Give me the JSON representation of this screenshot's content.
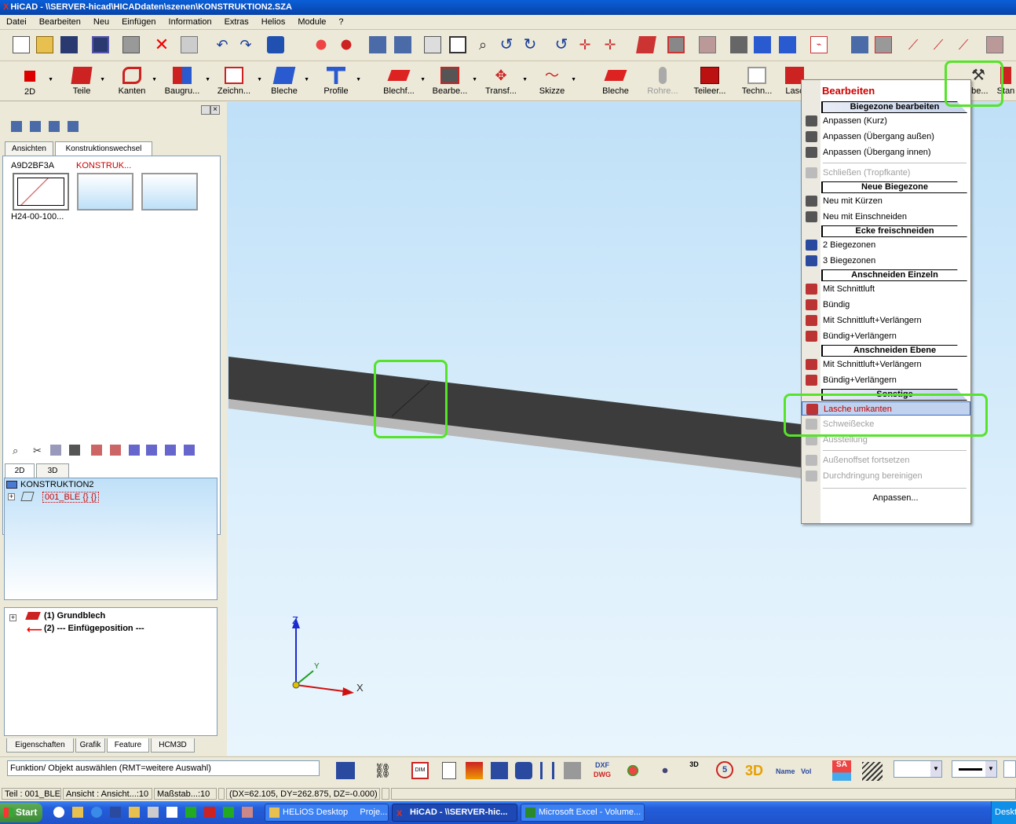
{
  "window": {
    "title": "HiCAD - \\\\SERVER-hicad\\HICADdaten\\szenen\\KONSTRUKTION2.SZA",
    "logo": "X"
  },
  "menu": [
    "Datei",
    "Bearbeiten",
    "Neu",
    "Einfügen",
    "Information",
    "Extras",
    "Helios",
    "Module",
    "?"
  ],
  "toolbar2": [
    {
      "label": "2D",
      "icon": "red-square"
    },
    {
      "label": "Teile",
      "icon": "red-cube"
    },
    {
      "label": "Kanten",
      "icon": "red-edge"
    },
    {
      "label": "Baugru...",
      "icon": "assembly"
    },
    {
      "label": "Zeichn...",
      "icon": "drawing"
    },
    {
      "label": "Bleche",
      "icon": "sheet"
    },
    {
      "label": "Profile",
      "icon": "profile"
    },
    {
      "label": "Blechf...",
      "icon": "sheet-feature"
    },
    {
      "label": "Bearbe...",
      "icon": "edit-solid"
    },
    {
      "label": "Transf...",
      "icon": "transform"
    },
    {
      "label": "Skizze",
      "icon": "sketch"
    },
    {
      "label": "Bleche",
      "icon": "sheet-red"
    },
    {
      "label": "Rohre...",
      "icon": "pipe"
    },
    {
      "label": "Teileer...",
      "icon": "part-create"
    },
    {
      "label": "Techn...",
      "icon": "tech"
    },
    {
      "label": "Lasc",
      "icon": "tab"
    },
    {
      "label": "rbe...",
      "icon": "hammer-icon"
    },
    {
      "label": "Stan",
      "icon": "standard"
    }
  ],
  "left": {
    "tabs_top": [
      "Ansichten",
      "Konstruktionswechsel"
    ],
    "thumbs": [
      {
        "label": "A9D2BF3A",
        "caption": "H24-00-100..."
      },
      {
        "label": "KONSTRUK..."
      },
      {
        "label": ""
      }
    ],
    "tabs_mid": [
      "2D",
      "3D"
    ],
    "tree_root": "KONSTRUKTION2",
    "tree_child": "001_BLE {} {}",
    "feature_items": [
      "(1) Grundblech",
      "(2) --- Einfügeposition ---"
    ],
    "tabs_bottom": [
      "Eigenschaften",
      "Grafik",
      "Feature",
      "HCM3D"
    ]
  },
  "axes": {
    "z": "Z",
    "y": "Y",
    "x": "X"
  },
  "context_menu": {
    "title": "Bearbeiten",
    "sections": [
      {
        "header": "Biegezone bearbeiten",
        "items": [
          {
            "t": "Anpassen (Kurz)"
          },
          {
            "t": "Anpassen (Übergang außen)"
          },
          {
            "t": "Anpassen (Übergang innen)"
          },
          {
            "t": "Schließen (Tropfkante)",
            "dis": true
          }
        ]
      },
      {
        "header": "Neue Biegezone",
        "items": [
          {
            "t": "Neu mit Kürzen"
          },
          {
            "t": "Neu mit Einschneiden"
          }
        ]
      },
      {
        "header": "Ecke freischneiden",
        "items": [
          {
            "t": "2 Biegezonen"
          },
          {
            "t": "3 Biegezonen"
          }
        ]
      },
      {
        "header": "Anschneiden Einzeln",
        "items": [
          {
            "t": "Mit Schnittluft"
          },
          {
            "t": "Bündig"
          },
          {
            "t": "Mit Schnittluft+Verlängern"
          },
          {
            "t": "Bündig+Verlängern"
          }
        ]
      },
      {
        "header": "Anschneiden Ebene",
        "items": [
          {
            "t": "Mit Schnittluft+Verlängern"
          },
          {
            "t": "Bündig+Verlängern"
          }
        ]
      },
      {
        "header": "Sonstige",
        "items": [
          {
            "t": "Lasche umkanten",
            "hi": true
          },
          {
            "t": "Schweißecke",
            "dis": true
          },
          {
            "t": "Ausstellung",
            "dis": true
          },
          {
            "t": "Außenoffset fortsetzen",
            "dis": true
          },
          {
            "t": "Durchdringung bereinigen",
            "dis": true
          }
        ]
      }
    ],
    "footer": "Anpassen..."
  },
  "command": {
    "prompt": "Funktion/ Objekt auswählen (RMT=weitere Auswahl)"
  },
  "status": {
    "part": "Teil : 001_BLE",
    "view": "Ansicht : Ansicht...:10",
    "scale": "Maßstab...:10",
    "coords": "(DX=62.105, DY=262.875, DZ=-0.000)"
  },
  "taskbar": {
    "start": "Start",
    "tasks": [
      "HELiOS Desktop     Proje...",
      "HiCAD - \\\\SERVER-hic...",
      "Microsoft Excel - Volume..."
    ],
    "tray": "Deskt"
  },
  "colors": {
    "title": "#0842a8",
    "highlight": "#56e32a",
    "menu_red": "#d00000",
    "taskbar": "#245edb"
  }
}
